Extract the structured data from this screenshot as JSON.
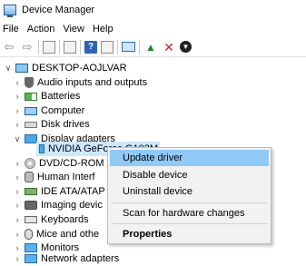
{
  "window": {
    "title": "Device Manager"
  },
  "menubar": {
    "items": [
      "File",
      "Action",
      "View",
      "Help"
    ]
  },
  "toolbar": {
    "buttons": [
      "back-arrow-icon",
      "forward-arrow-icon",
      "properties-icon",
      "show-hide-icon",
      "help-icon",
      "console-tree-icon",
      "monitor-icon",
      "update-driver-icon",
      "uninstall-icon",
      "scan-icon"
    ]
  },
  "tree": {
    "root": "DESKTOP-AOJLVAR",
    "items": [
      {
        "label": "Audio inputs and outputs",
        "expanded": false,
        "icon": "audio-icon"
      },
      {
        "label": "Batteries",
        "expanded": false,
        "icon": "battery-icon"
      },
      {
        "label": "Computer",
        "expanded": false,
        "icon": "computer-icon"
      },
      {
        "label": "Disk drives",
        "expanded": false,
        "icon": "disk-icon"
      },
      {
        "label": "Display adapters",
        "expanded": true,
        "icon": "display-icon"
      },
      {
        "label": "NVIDIA GeForce G103M",
        "child": true,
        "icon": "display-icon"
      },
      {
        "label": "DVD/CD-ROM",
        "expanded": false,
        "icon": "dvd-icon"
      },
      {
        "label": "Human Interf",
        "expanded": false,
        "icon": "hid-icon"
      },
      {
        "label": "IDE ATA/ATAP",
        "expanded": false,
        "icon": "ide-icon"
      },
      {
        "label": "Imaging devic",
        "expanded": false,
        "icon": "imaging-icon"
      },
      {
        "label": "Keyboards",
        "expanded": false,
        "icon": "keyboard-icon"
      },
      {
        "label": "Mice and othe",
        "expanded": false,
        "icon": "mice-icon"
      },
      {
        "label": "Monitors",
        "expanded": false,
        "icon": "monitor-icon"
      },
      {
        "label": "Network adapters",
        "expanded": false,
        "icon": "network-icon"
      }
    ]
  },
  "context_menu": {
    "items": [
      "Update driver",
      "Disable device",
      "Uninstall device",
      "Scan for hardware changes",
      "Properties"
    ],
    "highlighted": "Update driver"
  },
  "colors": {
    "hover": "#91c9f7",
    "selection": "#cce8ff"
  }
}
